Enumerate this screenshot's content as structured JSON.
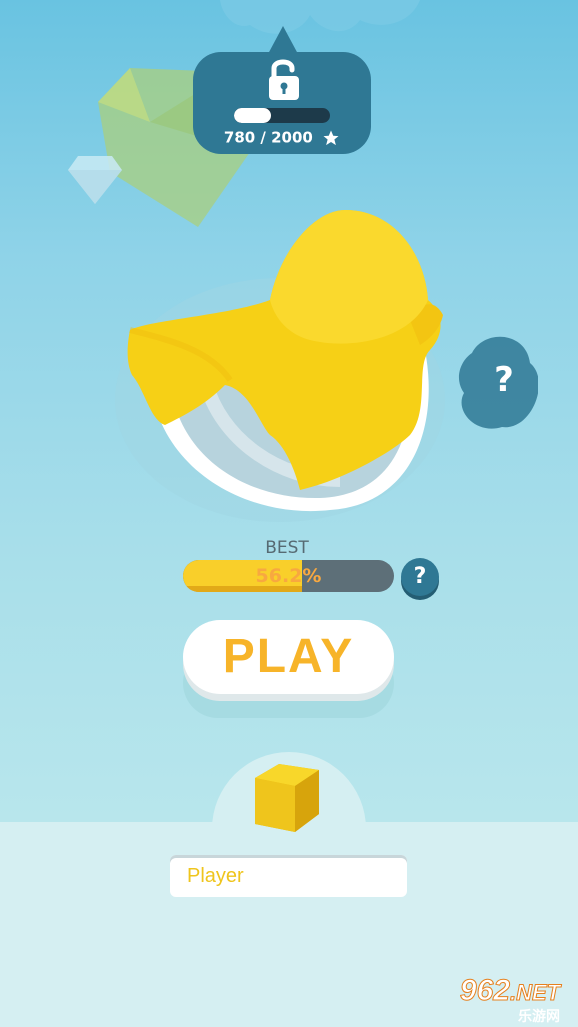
{
  "unlock": {
    "progress_text": "780 / 2000",
    "progress_fraction": 0.39,
    "icon": "lock-open-icon",
    "star_icon": "star-icon"
  },
  "help": {
    "label": "?"
  },
  "best": {
    "label": "BEST",
    "percent_text": "56.2%",
    "percent_value": 56.2,
    "help_label": "?"
  },
  "play": {
    "label": "PLAY"
  },
  "player": {
    "value": "Player"
  },
  "watermark": {
    "text": "962",
    "suffix": ".NET",
    "sub": "乐游网"
  },
  "colors": {
    "accent_yellow": "#f9cf2a",
    "play_text": "#f7b429",
    "panel_blue": "#2f7894",
    "background": "#8fd3e8"
  }
}
